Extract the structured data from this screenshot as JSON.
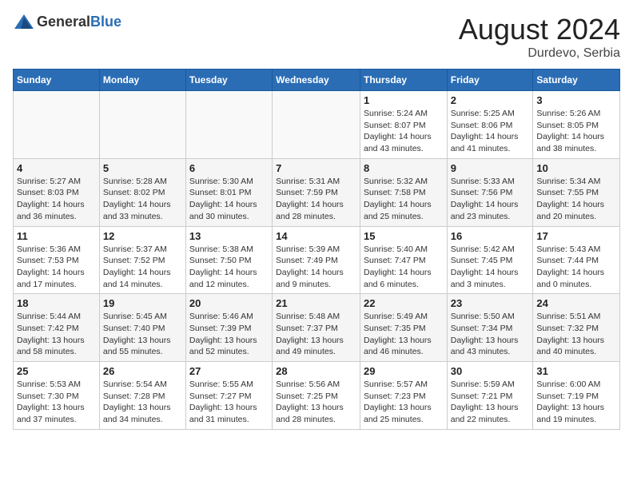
{
  "header": {
    "logo_general": "General",
    "logo_blue": "Blue",
    "month_year": "August 2024",
    "location": "Durdevo, Serbia"
  },
  "weekdays": [
    "Sunday",
    "Monday",
    "Tuesday",
    "Wednesday",
    "Thursday",
    "Friday",
    "Saturday"
  ],
  "weeks": [
    [
      {
        "day": "",
        "info": ""
      },
      {
        "day": "",
        "info": ""
      },
      {
        "day": "",
        "info": ""
      },
      {
        "day": "",
        "info": ""
      },
      {
        "day": "1",
        "info": "Sunrise: 5:24 AM\nSunset: 8:07 PM\nDaylight: 14 hours\nand 43 minutes."
      },
      {
        "day": "2",
        "info": "Sunrise: 5:25 AM\nSunset: 8:06 PM\nDaylight: 14 hours\nand 41 minutes."
      },
      {
        "day": "3",
        "info": "Sunrise: 5:26 AM\nSunset: 8:05 PM\nDaylight: 14 hours\nand 38 minutes."
      }
    ],
    [
      {
        "day": "4",
        "info": "Sunrise: 5:27 AM\nSunset: 8:03 PM\nDaylight: 14 hours\nand 36 minutes."
      },
      {
        "day": "5",
        "info": "Sunrise: 5:28 AM\nSunset: 8:02 PM\nDaylight: 14 hours\nand 33 minutes."
      },
      {
        "day": "6",
        "info": "Sunrise: 5:30 AM\nSunset: 8:01 PM\nDaylight: 14 hours\nand 30 minutes."
      },
      {
        "day": "7",
        "info": "Sunrise: 5:31 AM\nSunset: 7:59 PM\nDaylight: 14 hours\nand 28 minutes."
      },
      {
        "day": "8",
        "info": "Sunrise: 5:32 AM\nSunset: 7:58 PM\nDaylight: 14 hours\nand 25 minutes."
      },
      {
        "day": "9",
        "info": "Sunrise: 5:33 AM\nSunset: 7:56 PM\nDaylight: 14 hours\nand 23 minutes."
      },
      {
        "day": "10",
        "info": "Sunrise: 5:34 AM\nSunset: 7:55 PM\nDaylight: 14 hours\nand 20 minutes."
      }
    ],
    [
      {
        "day": "11",
        "info": "Sunrise: 5:36 AM\nSunset: 7:53 PM\nDaylight: 14 hours\nand 17 minutes."
      },
      {
        "day": "12",
        "info": "Sunrise: 5:37 AM\nSunset: 7:52 PM\nDaylight: 14 hours\nand 14 minutes."
      },
      {
        "day": "13",
        "info": "Sunrise: 5:38 AM\nSunset: 7:50 PM\nDaylight: 14 hours\nand 12 minutes."
      },
      {
        "day": "14",
        "info": "Sunrise: 5:39 AM\nSunset: 7:49 PM\nDaylight: 14 hours\nand 9 minutes."
      },
      {
        "day": "15",
        "info": "Sunrise: 5:40 AM\nSunset: 7:47 PM\nDaylight: 14 hours\nand 6 minutes."
      },
      {
        "day": "16",
        "info": "Sunrise: 5:42 AM\nSunset: 7:45 PM\nDaylight: 14 hours\nand 3 minutes."
      },
      {
        "day": "17",
        "info": "Sunrise: 5:43 AM\nSunset: 7:44 PM\nDaylight: 14 hours\nand 0 minutes."
      }
    ],
    [
      {
        "day": "18",
        "info": "Sunrise: 5:44 AM\nSunset: 7:42 PM\nDaylight: 13 hours\nand 58 minutes."
      },
      {
        "day": "19",
        "info": "Sunrise: 5:45 AM\nSunset: 7:40 PM\nDaylight: 13 hours\nand 55 minutes."
      },
      {
        "day": "20",
        "info": "Sunrise: 5:46 AM\nSunset: 7:39 PM\nDaylight: 13 hours\nand 52 minutes."
      },
      {
        "day": "21",
        "info": "Sunrise: 5:48 AM\nSunset: 7:37 PM\nDaylight: 13 hours\nand 49 minutes."
      },
      {
        "day": "22",
        "info": "Sunrise: 5:49 AM\nSunset: 7:35 PM\nDaylight: 13 hours\nand 46 minutes."
      },
      {
        "day": "23",
        "info": "Sunrise: 5:50 AM\nSunset: 7:34 PM\nDaylight: 13 hours\nand 43 minutes."
      },
      {
        "day": "24",
        "info": "Sunrise: 5:51 AM\nSunset: 7:32 PM\nDaylight: 13 hours\nand 40 minutes."
      }
    ],
    [
      {
        "day": "25",
        "info": "Sunrise: 5:53 AM\nSunset: 7:30 PM\nDaylight: 13 hours\nand 37 minutes."
      },
      {
        "day": "26",
        "info": "Sunrise: 5:54 AM\nSunset: 7:28 PM\nDaylight: 13 hours\nand 34 minutes."
      },
      {
        "day": "27",
        "info": "Sunrise: 5:55 AM\nSunset: 7:27 PM\nDaylight: 13 hours\nand 31 minutes."
      },
      {
        "day": "28",
        "info": "Sunrise: 5:56 AM\nSunset: 7:25 PM\nDaylight: 13 hours\nand 28 minutes."
      },
      {
        "day": "29",
        "info": "Sunrise: 5:57 AM\nSunset: 7:23 PM\nDaylight: 13 hours\nand 25 minutes."
      },
      {
        "day": "30",
        "info": "Sunrise: 5:59 AM\nSunset: 7:21 PM\nDaylight: 13 hours\nand 22 minutes."
      },
      {
        "day": "31",
        "info": "Sunrise: 6:00 AM\nSunset: 7:19 PM\nDaylight: 13 hours\nand 19 minutes."
      }
    ]
  ]
}
